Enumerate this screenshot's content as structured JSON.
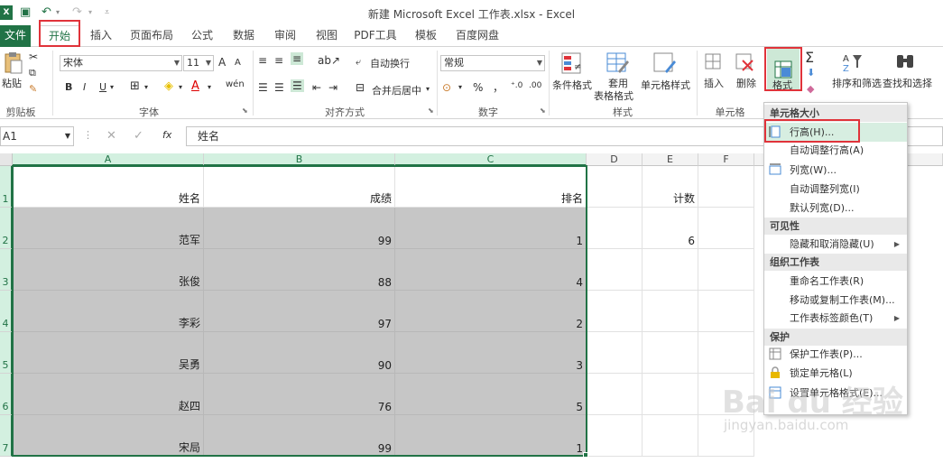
{
  "window": {
    "title": "新建 Microsoft Excel 工作表.xlsx - Excel"
  },
  "tabs": [
    "文件",
    "开始",
    "插入",
    "页面布局",
    "公式",
    "数据",
    "审阅",
    "视图",
    "PDF工具",
    "模板",
    "百度网盘"
  ],
  "ribbon": {
    "clipboard": {
      "paste": "粘贴",
      "label": "剪贴板"
    },
    "font": {
      "name": "宋体",
      "size": "11",
      "bold": "B",
      "italic": "I",
      "underline": "U",
      "label": "字体",
      "wen": "wén",
      "grow": "A",
      "shrink": "A"
    },
    "alignment": {
      "wrap": "自动换行",
      "merge": "合并后居中",
      "label": "对齐方式"
    },
    "number": {
      "format": "常规",
      "percent": "%",
      "comma": "，",
      "label": "数字"
    },
    "styles": {
      "conditional": "条件格式",
      "table1": "套用",
      "table2": "表格格式",
      "cellstyle": "单元格样式",
      "label": "样式"
    },
    "cells": {
      "insert": "插入",
      "delete": "删除",
      "format": "格式",
      "label": "单元格"
    },
    "editing": {
      "sort": "排序和筛选",
      "find": "查找和选择"
    }
  },
  "formula_bar": {
    "cell_ref": "A1",
    "content": "姓名",
    "fx": "fx"
  },
  "columns": [
    "A",
    "B",
    "C",
    "D",
    "E",
    "F"
  ],
  "rows": [
    {
      "num": "1",
      "a": "姓名",
      "b": "成绩",
      "c": "排名",
      "e": "计数"
    },
    {
      "num": "2",
      "a": "范军",
      "b": "99",
      "c": "1",
      "e": "6"
    },
    {
      "num": "3",
      "a": "张俊",
      "b": "88",
      "c": "4",
      "e": ""
    },
    {
      "num": "4",
      "a": "李彩",
      "b": "97",
      "c": "2",
      "e": ""
    },
    {
      "num": "5",
      "a": "吴勇",
      "b": "90",
      "c": "3",
      "e": ""
    },
    {
      "num": "6",
      "a": "赵四",
      "b": "76",
      "c": "5",
      "e": ""
    },
    {
      "num": "7",
      "a": "宋局",
      "b": "99",
      "c": "1",
      "e": ""
    }
  ],
  "menu": {
    "sec_size": "单元格大小",
    "row_height": "行高(H)...",
    "autofit_row": "自动调整行高(A)",
    "col_width": "列宽(W)...",
    "autofit_col": "自动调整列宽(I)",
    "default_width": "默认列宽(D)...",
    "sec_visibility": "可见性",
    "hide_unhide": "隐藏和取消隐藏(U)",
    "sec_organize": "组织工作表",
    "rename": "重命名工作表(R)",
    "move_copy": "移动或复制工作表(M)...",
    "tab_color": "工作表标签颜色(T)",
    "sec_protect": "保护",
    "protect_sheet": "保护工作表(P)...",
    "lock_cell": "锁定单元格(L)",
    "format_cells": "设置单元格格式(E)..."
  },
  "watermark": {
    "brand": "Bai du 经验",
    "url": "jingyan.baidu.com"
  },
  "colors": {
    "excel_green": "#217346",
    "highlight_red": "#e0333a",
    "selection_gray": "#c6c6c6"
  }
}
